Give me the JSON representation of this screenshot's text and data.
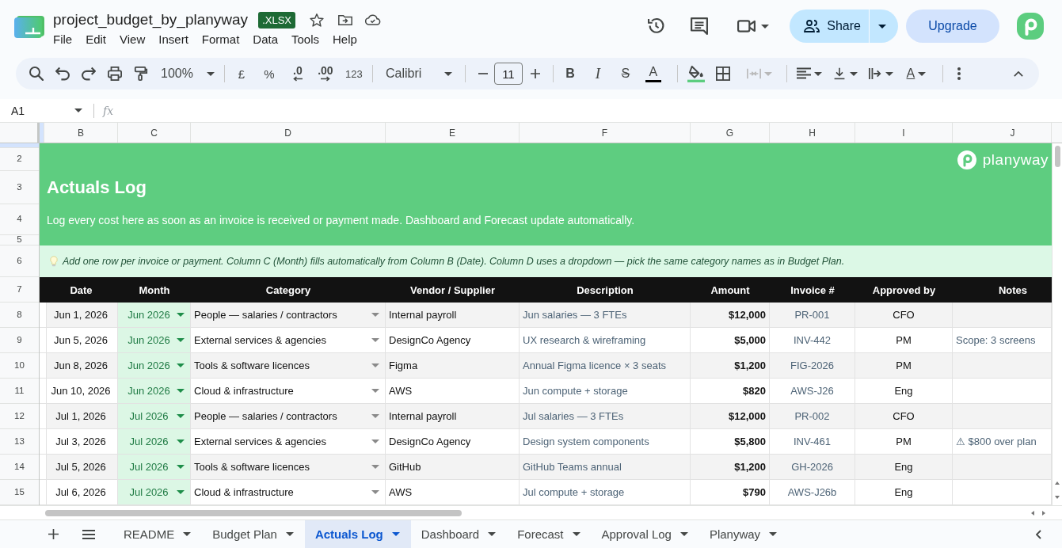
{
  "document": {
    "title": "project_budget_by_planyway",
    "format_badge": ".XLSX"
  },
  "menu": [
    "File",
    "Edit",
    "View",
    "Insert",
    "Format",
    "Data",
    "Tools",
    "Help"
  ],
  "actions": {
    "share": "Share",
    "upgrade": "Upgrade"
  },
  "toolbar": {
    "zoom": "100%",
    "currency": "£",
    "percent": "%",
    "decrease_decimal": ".0",
    "increase_decimal": ".00",
    "number_format": "123",
    "font": "Calibri",
    "font_size": "11",
    "bold": "B",
    "italic": "I",
    "strikethrough": "S",
    "text_color": "A",
    "text_rotation": "A",
    "merge_cells": {
      "disabled": true
    }
  },
  "formula_bar": {
    "cell": "A1",
    "fx": "fx"
  },
  "column_headers": [
    "B",
    "C",
    "D",
    "E",
    "F",
    "G",
    "H",
    "I",
    "J"
  ],
  "row_numbers": [
    "2",
    "3",
    "4",
    "5",
    "6",
    "7",
    "8",
    "9",
    "10",
    "11",
    "12",
    "13",
    "14",
    "15"
  ],
  "banner": {
    "brand": "planyway",
    "title": "Actuals Log",
    "subtitle": "Log every cost here as soon as an invoice is received or payment made. Dashboard and Forecast update automatically."
  },
  "tip": "Add one row per invoice or payment. Column C (Month) fills automatically from Column B (Date). Column D uses a dropdown — pick the same category names as in Budget Plan.",
  "table": {
    "columns": [
      "Date",
      "Month",
      "Category",
      "Vendor / Supplier",
      "Description",
      "Amount",
      "Invoice #",
      "Approved by",
      "Notes"
    ],
    "rows": [
      {
        "date": "Jun 1, 2026",
        "month": "Jun 2026",
        "category": "People — salaries / contractors",
        "vendor": "Internal payroll",
        "description": "Jun salaries — 3 FTEs",
        "amount": "$12,000",
        "invoice": "PR-001",
        "approved_by": "CFO"
      },
      {
        "date": "Jun 5, 2026",
        "month": "Jun 2026",
        "category": "External services & agencies",
        "vendor": "DesignCo Agency",
        "description": "UX research & wireframing",
        "amount": "$5,000",
        "invoice": "INV-442",
        "approved_by": "PM",
        "notes": "Scope: 3 screens"
      },
      {
        "date": "Jun 8, 2026",
        "month": "Jun 2026",
        "category": "Tools & software licences",
        "vendor": "Figma",
        "description": "Annual Figma licence × 3 seats",
        "amount": "$1,200",
        "invoice": "FIG-2026",
        "approved_by": "PM"
      },
      {
        "date": "Jun 10, 2026",
        "month": "Jun 2026",
        "category": "Cloud & infrastructure",
        "vendor": "AWS",
        "description": "Jun compute + storage",
        "amount": "$820",
        "invoice": "AWS-J26",
        "approved_by": "Eng"
      },
      {
        "date": "Jul 1, 2026",
        "month": "Jul 2026",
        "category": "People — salaries / contractors",
        "vendor": "Internal payroll",
        "description": "Jul salaries — 3 FTEs",
        "amount": "$12,000",
        "invoice": "PR-002",
        "approved_by": "CFO"
      },
      {
        "date": "Jul 3, 2026",
        "month": "Jul 2026",
        "category": "External services & agencies",
        "vendor": "DesignCo Agency",
        "description": "Design system components",
        "amount": "$5,800",
        "invoice": "INV-461",
        "approved_by": "PM",
        "notes": "⚠ $800 over plan"
      },
      {
        "date": "Jul 5, 2026",
        "month": "Jul 2026",
        "category": "Tools & software licences",
        "vendor": "GitHub",
        "description": "GitHub Teams annual",
        "amount": "$1,200",
        "invoice": "GH-2026",
        "approved_by": "Eng"
      },
      {
        "date": "Jul 6, 2026",
        "month": "Jul 2026",
        "category": "Cloud & infrastructure",
        "vendor": "AWS",
        "description": "Jul compute + storage",
        "amount": "$790",
        "invoice": "AWS-J26b",
        "approved_by": "Eng"
      }
    ]
  },
  "sheet_tabs": [
    {
      "label": "README",
      "selected": false
    },
    {
      "label": "Budget Plan",
      "selected": false
    },
    {
      "label": "Actuals Log",
      "selected": true
    },
    {
      "label": "Dashboard",
      "selected": false
    },
    {
      "label": "Forecast",
      "selected": false
    },
    {
      "label": "Approval Log",
      "selected": false
    },
    {
      "label": "Planyway",
      "selected": false
    }
  ]
}
